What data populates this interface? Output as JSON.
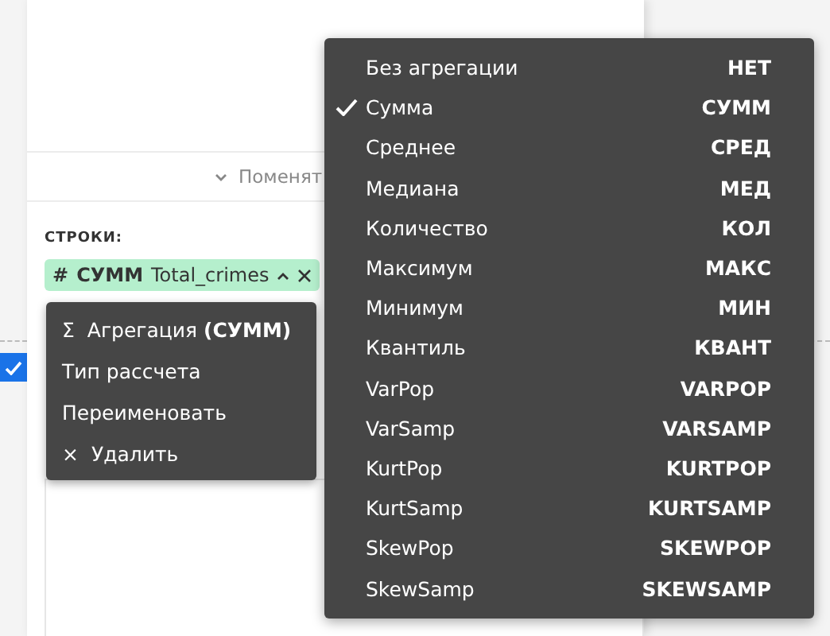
{
  "side_checkbox": {
    "checked": true
  },
  "swap_button": {
    "label": "Поменят"
  },
  "rows_section": {
    "label": "СТРОКИ:",
    "pill": {
      "icon": "#",
      "aggregation": "СУММ",
      "field": "Total_crimes",
      "expanded": true
    }
  },
  "context_menu": {
    "items": [
      {
        "icon": "Σ",
        "label": "Агрегация **(СУММ)**"
      },
      {
        "label": "Тип рассчета"
      },
      {
        "label": "Переименовать"
      },
      {
        "icon": "×",
        "label": "Удалить"
      }
    ]
  },
  "aggregation_menu": {
    "items": [
      {
        "label": "Без агрегации",
        "code": "НЕТ",
        "selected": false
      },
      {
        "label": "Сумма",
        "code": "СУММ",
        "selected": true
      },
      {
        "label": "Среднее",
        "code": "СРЕД",
        "selected": false
      },
      {
        "label": "Медиана",
        "code": "МЕД",
        "selected": false
      },
      {
        "label": "Количество",
        "code": "КОЛ",
        "selected": false
      },
      {
        "label": "Максимум",
        "code": "МАКС",
        "selected": false
      },
      {
        "label": "Минимум",
        "code": "МИН",
        "selected": false
      },
      {
        "label": "Квантиль",
        "code": "КВАНТ",
        "selected": false
      },
      {
        "label": "VarPop",
        "code": "VARPOP",
        "selected": false
      },
      {
        "label": "VarSamp",
        "code": "VARSAMP",
        "selected": false
      },
      {
        "label": "KurtPop",
        "code": "KURTPOP",
        "selected": false
      },
      {
        "label": "KurtSamp",
        "code": "KURTSAMP",
        "selected": false
      },
      {
        "label": "SkewPop",
        "code": "SKEWPOP",
        "selected": false
      },
      {
        "label": "SkewSamp",
        "code": "SKEWSAMP",
        "selected": false
      }
    ]
  }
}
